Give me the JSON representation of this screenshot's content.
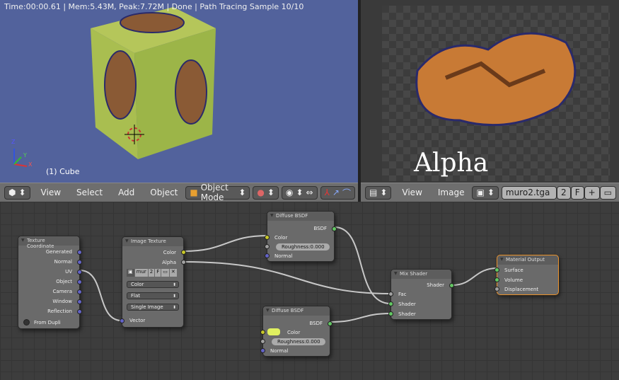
{
  "viewport": {
    "status": "Time:00:00.61 | Mem:5.43M, Peak:7.72M | Done | Path Tracing Sample 10/10",
    "object_label": "(1) Cube",
    "axes": {
      "x": "X",
      "y": "Y",
      "z": "Z"
    }
  },
  "image_editor": {
    "overlay_text": "Alpha"
  },
  "view3d_header": {
    "menus": [
      "View",
      "Select",
      "Add",
      "Object"
    ],
    "mode": "Object Mode"
  },
  "image_header": {
    "menus": [
      "View",
      "Image"
    ],
    "image_name": "muro2.tga",
    "users": "2",
    "fake": "F"
  },
  "nodes": {
    "texcoord": {
      "title": "Texture Coordinate",
      "outputs": [
        "Generated",
        "Normal",
        "UV",
        "Object",
        "Camera",
        "Window",
        "Reflection"
      ],
      "checkbox": "From Dupli"
    },
    "imgtex": {
      "title": "Image Texture",
      "outputs": [
        "Color",
        "Alpha"
      ],
      "image": "mur",
      "users": "2",
      "fake": "F",
      "color_space": "Color",
      "projection": "Flat",
      "source": "Single Image",
      "input": "Vector"
    },
    "diffuse1": {
      "title": "Diffuse BSDF",
      "output": "BSDF",
      "inputs": [
        "Color",
        "Normal"
      ],
      "roughness_label": "Roughness:",
      "roughness": "0.000"
    },
    "diffuse2": {
      "title": "Diffuse BSDF",
      "output": "BSDF",
      "inputs": [
        "Color",
        "Normal"
      ],
      "roughness_label": "Roughness:",
      "roughness": "0.000",
      "color": "#e0f060"
    },
    "mix": {
      "title": "Mix Shader",
      "output": "Shader",
      "inputs": [
        "Fac",
        "Shader",
        "Shader"
      ]
    },
    "output": {
      "title": "Material Output",
      "inputs": [
        "Surface",
        "Volume",
        "Displacement"
      ]
    }
  }
}
